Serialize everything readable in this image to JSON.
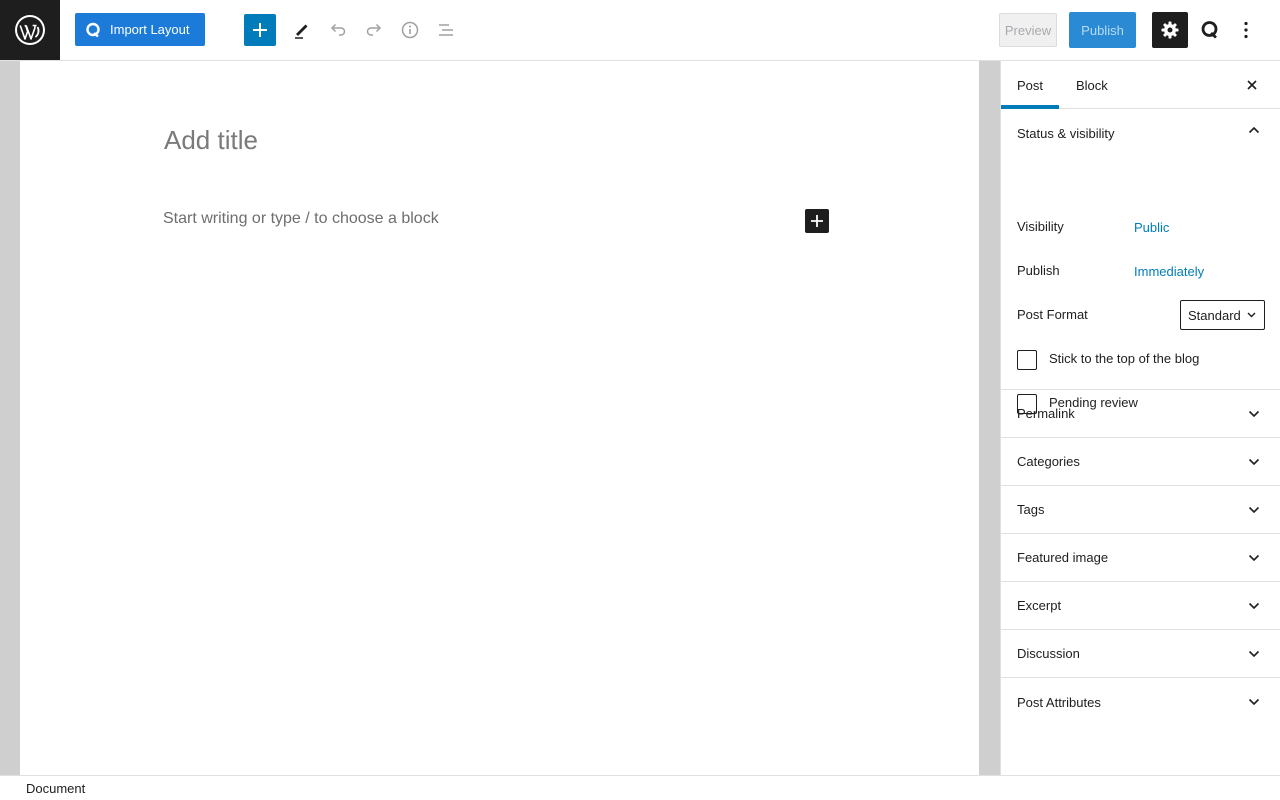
{
  "header": {
    "import_label": "Import Layout",
    "preview_label": "Preview",
    "publish_label": "Publish",
    "icons": [
      "wordpress-logo",
      "qubely-q-icon",
      "plus-icon",
      "pencil-icon",
      "undo-icon",
      "redo-icon",
      "info-icon",
      "list-view-icon",
      "gear-icon",
      "more-vertical-icon"
    ]
  },
  "editor": {
    "title_placeholder": "Add title",
    "block_placeholder": "Start writing or type / to choose a block"
  },
  "sidebar": {
    "tabs": [
      {
        "label": "Post",
        "active": true
      },
      {
        "label": "Block",
        "active": false
      }
    ],
    "status": {
      "heading": "Status & visibility",
      "visibility_label": "Visibility",
      "visibility_value": "Public",
      "publish_label": "Publish",
      "publish_value": "Immediately",
      "format_label": "Post Format",
      "format_value": "Standard",
      "sticky_label": "Stick to the top of the blog",
      "sticky_checked": false,
      "pending_label": "Pending review",
      "pending_checked": false
    },
    "panels": [
      "Permalink",
      "Categories",
      "Tags",
      "Featured image",
      "Excerpt",
      "Discussion",
      "Post Attributes"
    ]
  },
  "footer": {
    "breadcrumb": "Document"
  },
  "colors": {
    "accent": "#007cba",
    "import_button": "#1c7bd9",
    "dark": "#1e1e1e"
  }
}
